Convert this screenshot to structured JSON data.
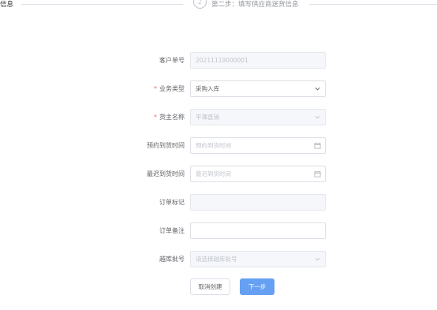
{
  "steps": {
    "step1_label": "信息",
    "step2_number": "2",
    "step2_label": "第二步：填写供应商送货信息"
  },
  "form": {
    "customer_no": {
      "label": "客户单号",
      "value": "20211119000001"
    },
    "business_type": {
      "label": "业务类型",
      "value": "采购入库",
      "required": true
    },
    "owner_name": {
      "label": "货主名称",
      "value": "平潭直销",
      "required": true
    },
    "appointment_time": {
      "label": "预约到货时间",
      "placeholder": "预约到货时间"
    },
    "latest_time": {
      "label": "最迟到货时间",
      "placeholder": "最迟到货时间"
    },
    "order_mark": {
      "label": "订单标记",
      "value": ""
    },
    "order_note": {
      "label": "订单备注",
      "value": ""
    },
    "transit_batch": {
      "label": "越库批号",
      "placeholder": "请选择越库批号"
    }
  },
  "buttons": {
    "cancel": "取消创建",
    "next": "下一步"
  },
  "icons": {
    "chevron": "chevron-down-icon",
    "calendar": "calendar-icon"
  },
  "colors": {
    "primary": "#66a0f2",
    "required": "#f56c6c",
    "border": "#dcdfe6",
    "disabled_bg": "#f5f7fa"
  }
}
